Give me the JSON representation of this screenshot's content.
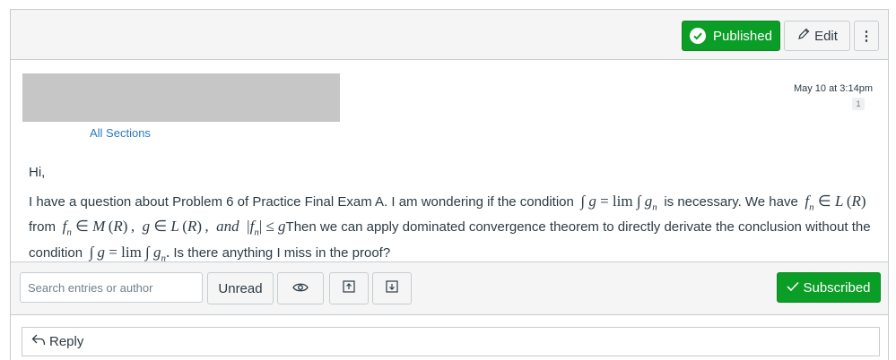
{
  "header": {
    "published_label": "Published",
    "edit_label": "Edit",
    "more_glyph": "⋮",
    "accent_green": "#0b9e27"
  },
  "post": {
    "sections_link": "All Sections",
    "date": "May 10 at 3:14pm",
    "reply_count": "1",
    "greeting": "Hi,",
    "body_1": "I have a question about Problem 6 of Practice Final Exam A. I am wondering if the condition",
    "body_2": "is necessary. We have",
    "body_3": "from",
    "body_4": "Then we can apply dominated convergence theorem to directly derivate the conclusion without the condition",
    "body_5": "Is there anything I miss in the proof?"
  },
  "toolbar": {
    "search_placeholder": "Search entries or author",
    "unread_label": "Unread",
    "subscribed_label": "Subscribed"
  },
  "reply": {
    "label": "Reply"
  }
}
